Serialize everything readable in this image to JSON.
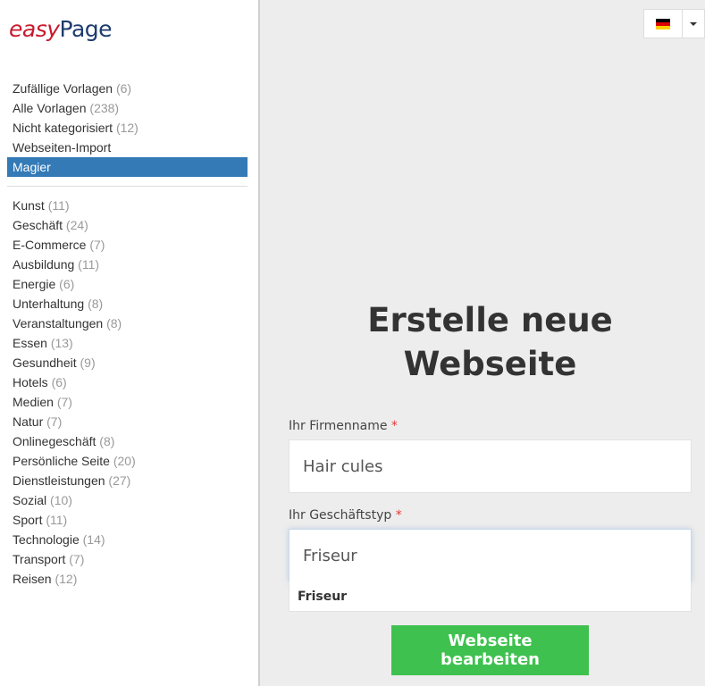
{
  "logo": {
    "part1": "easy",
    "part2": "Page"
  },
  "nav_primary": [
    {
      "label": "Zufällige Vorlagen",
      "count": "(6)"
    },
    {
      "label": "Alle Vorlagen",
      "count": "(238)"
    },
    {
      "label": "Nicht kategorisiert",
      "count": "(12)"
    },
    {
      "label": "Webseiten-Import",
      "count": ""
    },
    {
      "label": "Magier",
      "count": "",
      "active": true
    }
  ],
  "nav_categories": [
    {
      "label": "Kunst",
      "count": "(11)"
    },
    {
      "label": "Geschäft",
      "count": "(24)"
    },
    {
      "label": "E-Commerce",
      "count": "(7)"
    },
    {
      "label": "Ausbildung",
      "count": "(11)"
    },
    {
      "label": "Energie",
      "count": "(6)"
    },
    {
      "label": "Unterhaltung",
      "count": "(8)"
    },
    {
      "label": "Veranstaltungen",
      "count": "(8)"
    },
    {
      "label": "Essen",
      "count": "(13)"
    },
    {
      "label": "Gesundheit",
      "count": "(9)"
    },
    {
      "label": "Hotels",
      "count": "(6)"
    },
    {
      "label": "Medien",
      "count": "(7)"
    },
    {
      "label": "Natur",
      "count": "(7)"
    },
    {
      "label": "Onlinegeschäft",
      "count": "(8)"
    },
    {
      "label": "Persönliche Seite",
      "count": "(20)"
    },
    {
      "label": "Dienstleistungen",
      "count": "(27)"
    },
    {
      "label": "Sozial",
      "count": "(10)"
    },
    {
      "label": "Sport",
      "count": "(11)"
    },
    {
      "label": "Technologie",
      "count": "(14)"
    },
    {
      "label": "Transport",
      "count": "(7)"
    },
    {
      "label": "Reisen",
      "count": "(12)"
    }
  ],
  "language": {
    "current": "de",
    "flag_colors": [
      "#000000",
      "#dd0000",
      "#ffce00"
    ]
  },
  "main": {
    "title_line1": "Erstelle neue",
    "title_line2": "Webseite",
    "company_label": "Ihr Firmenname",
    "company_value": "Hair cules",
    "business_label": "Ihr Geschäftstyp",
    "business_value": "Friseur",
    "required_mark": "*",
    "suggestions": [
      "Friseur"
    ],
    "submit_label": "Webseite bearbeiten"
  },
  "colors": {
    "accent": "#337ab7",
    "button": "#3fc14f",
    "required": "#e53935"
  }
}
